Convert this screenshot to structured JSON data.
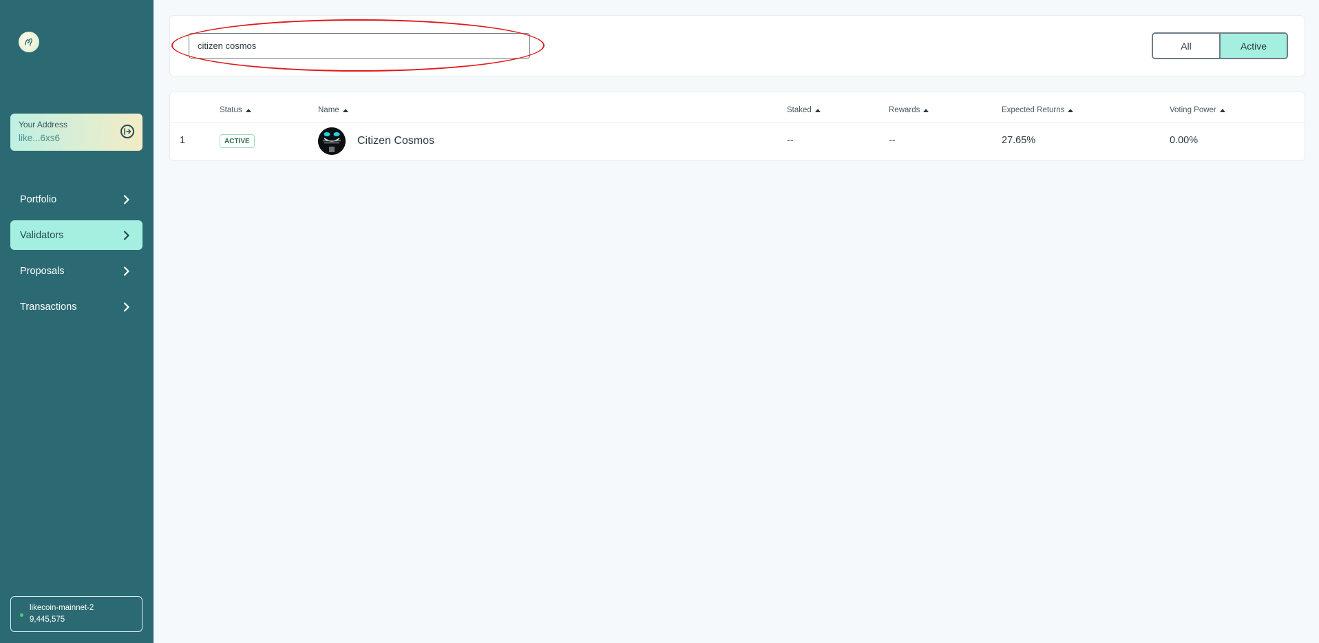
{
  "sidebar": {
    "address_label": "Your Address",
    "address_value": "like...6xs6",
    "nav": [
      {
        "label": "Portfolio",
        "active": false
      },
      {
        "label": "Validators",
        "active": true
      },
      {
        "label": "Proposals",
        "active": false
      },
      {
        "label": "Transactions",
        "active": false
      }
    ],
    "network": {
      "name": "likecoin-mainnet-2",
      "block_height": "9,445,575",
      "status_color": "#4ccf6b"
    }
  },
  "search": {
    "value": "citizen cosmos"
  },
  "filter": {
    "options": [
      "All",
      "Active"
    ],
    "selected": "Active"
  },
  "table": {
    "headers": {
      "status": "Status",
      "name": "Name",
      "staked": "Staked",
      "rewards": "Rewards",
      "expected_returns": "Expected Returns",
      "voting_power": "Voting Power"
    },
    "rows": [
      {
        "rank": "1",
        "status": "ACTIVE",
        "name": "Citizen Cosmos",
        "staked": "--",
        "rewards": "--",
        "expected_returns": "27.65%",
        "voting_power": "0.00%"
      }
    ]
  },
  "colors": {
    "sidebar_bg": "#2b6a72",
    "accent": "#a5efe0",
    "highlight_ellipse": "#e01b1b"
  }
}
